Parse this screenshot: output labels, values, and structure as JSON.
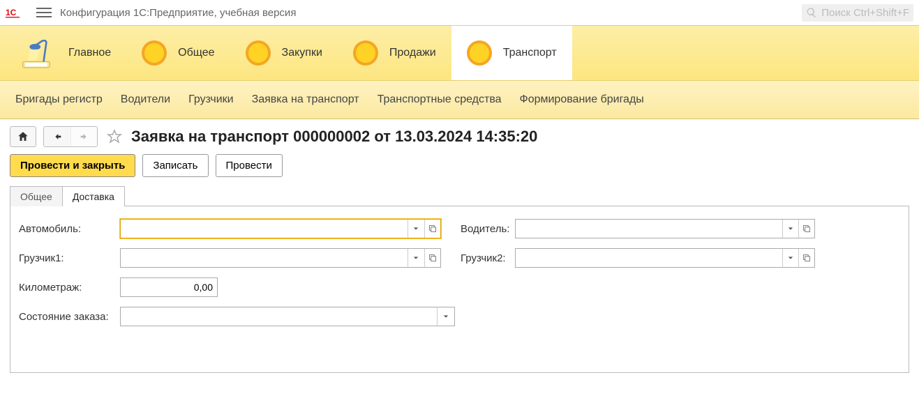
{
  "titlebar": {
    "title": "Конфигурация 1С:Предприятие, учебная версия",
    "search_placeholder": "Поиск Ctrl+Shift+F"
  },
  "sections": {
    "main": "Главное",
    "common": "Общее",
    "purchases": "Закупки",
    "sales": "Продажи",
    "transport": "Транспорт"
  },
  "submenu": {
    "brigades_register": "Бригады регистр",
    "drivers": "Водители",
    "loaders": "Грузчики",
    "transport_request": "Заявка на транспорт",
    "vehicles": "Транспортные средства",
    "brigade_forming": "Формирование бригады"
  },
  "document": {
    "title": "Заявка на транспорт 000000002 от 13.03.2024 14:35:20"
  },
  "buttons": {
    "post_and_close": "Провести и закрыть",
    "save": "Записать",
    "post": "Провести"
  },
  "tabs": {
    "general": "Общее",
    "delivery": "Доставка"
  },
  "form": {
    "car_label": "Автомобиль:",
    "car_value": "",
    "driver_label": "Водитель:",
    "driver_value": "",
    "loader1_label": "Грузчик1:",
    "loader1_value": "",
    "loader2_label": "Грузчик2:",
    "loader2_value": "",
    "mileage_label": "Километраж:",
    "mileage_value": "0,00",
    "order_state_label": "Состояние заказа:",
    "order_state_value": ""
  }
}
